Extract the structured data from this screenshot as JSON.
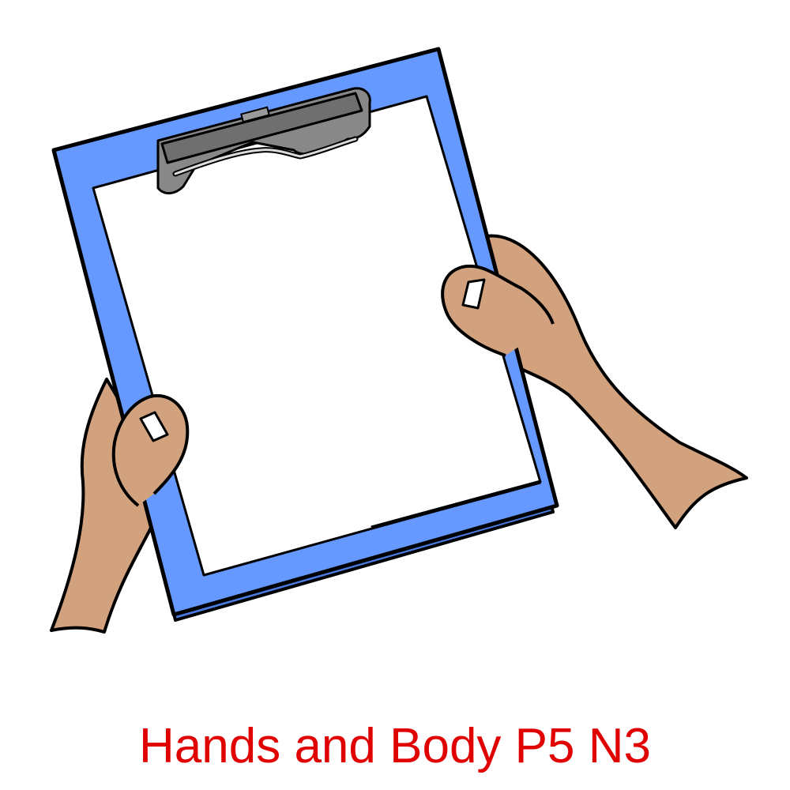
{
  "caption": {
    "text": "Hands and Body P5 N3",
    "color": "#e00000"
  },
  "illustration": {
    "subject": "hands-holding-clipboard",
    "colors": {
      "clipboard": "#6699ff",
      "clipboard_edge": "#4a7be0",
      "paper": "#ffffff",
      "skin": "#d2a27e",
      "clip": "#777777",
      "outline": "#000000",
      "fingernail": "#ffffff"
    }
  }
}
